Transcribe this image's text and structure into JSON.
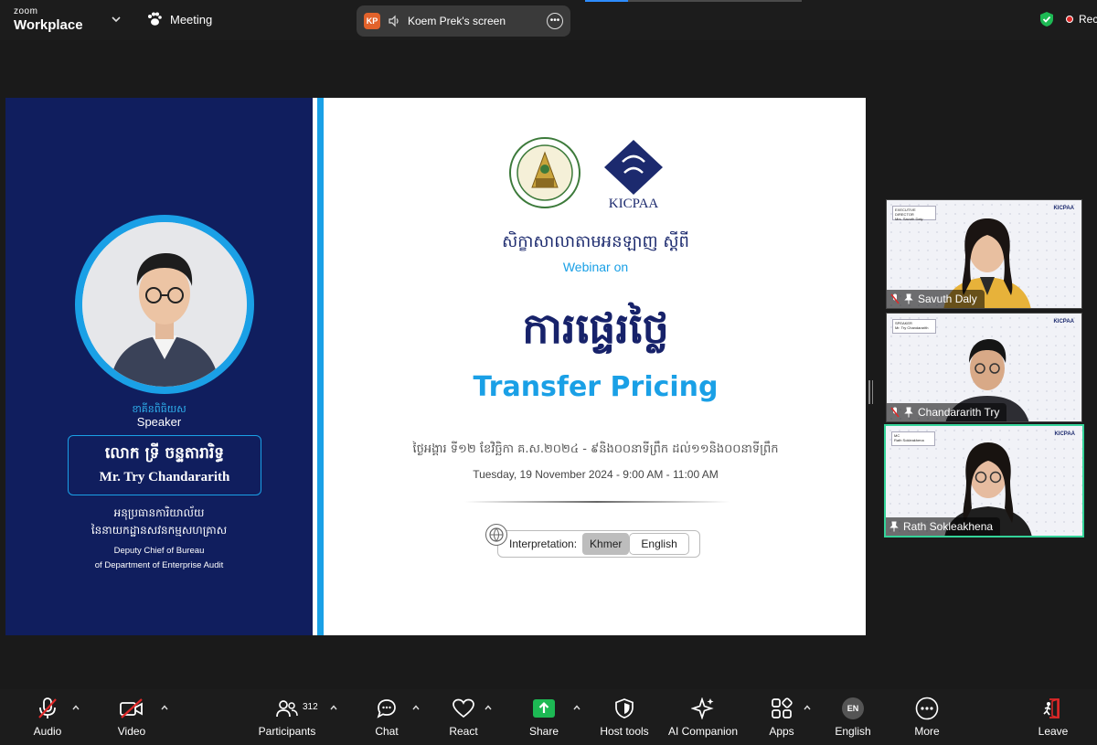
{
  "topbar": {
    "logo_small": "zoom",
    "logo_big": "Workplace",
    "meeting_label": "Meeting",
    "share_initials": "KP",
    "share_label": "Koem Prek's screen",
    "rec_label": "Rec",
    "progress_fraction": 0.2
  },
  "slide": {
    "speaker_km": "ខាគីនពិធិយស",
    "speaker_en": "Speaker",
    "name_km": "លោក ទ្រី ចន្ទតារារិទ្ធ",
    "name_en": "Mr. Try Chandararith",
    "role_km_1": "អនុប្រធានការិយាល័យ",
    "role_km_2": "នៃនាយកដ្ឋានសវនកម្មសហគ្រាស",
    "role_en_1": "Deputy Chief of Bureau",
    "role_en_2": "of Department of Enterprise Audit",
    "kicpaa_text": "KICPAA",
    "webinar_km": "សិក្ខាសាលាតាមអនឡាញ ស្តីពី",
    "webinar_en": "Webinar on",
    "title_km": "ការផ្ទេរថ្លៃ",
    "title_en": "Transfer Pricing",
    "date_km": "ថ្ងៃអង្គារ ទី១២ ខែវិច្ឆិកា គ.ស.២០២៤ - ៩និង០០នាទីព្រឹក ដល់១១និង០០នាទីព្រឹក",
    "date_en": "Tuesday, 19 November 2024 - 9:00 AM - 11:00 AM",
    "interp_label": "Interpretation:",
    "lang_km": "Khmer",
    "lang_en": "English"
  },
  "gallery": [
    {
      "name": "Savuth Daly",
      "badge_title": "EXECUTIVE DIRECTOR",
      "badge_name": "Mrs. Savuth Daly",
      "muted": true,
      "active": false
    },
    {
      "name": "Chandararith Try",
      "badge_title": "SPEAKER",
      "badge_name": "Mr. Try Chandararith",
      "muted": true,
      "active": false
    },
    {
      "name": "Rath Sokleakhena",
      "badge_title": "MC",
      "badge_name": "Rath Sokleakhena",
      "muted": false,
      "active": true
    }
  ],
  "toolbar": {
    "audio": "Audio",
    "video": "Video",
    "participants": "Participants",
    "participants_count": "312",
    "chat": "Chat",
    "react": "React",
    "share": "Share",
    "host_tools": "Host tools",
    "ai_companion": "AI Companion",
    "apps": "Apps",
    "english": "English",
    "english_badge": "EN",
    "more": "More",
    "leave": "Leave"
  },
  "colors": {
    "slide_navy": "#101e5e",
    "slide_accent": "#1aa0e6",
    "share_green": "#1db954",
    "active_tile": "#34d399"
  }
}
